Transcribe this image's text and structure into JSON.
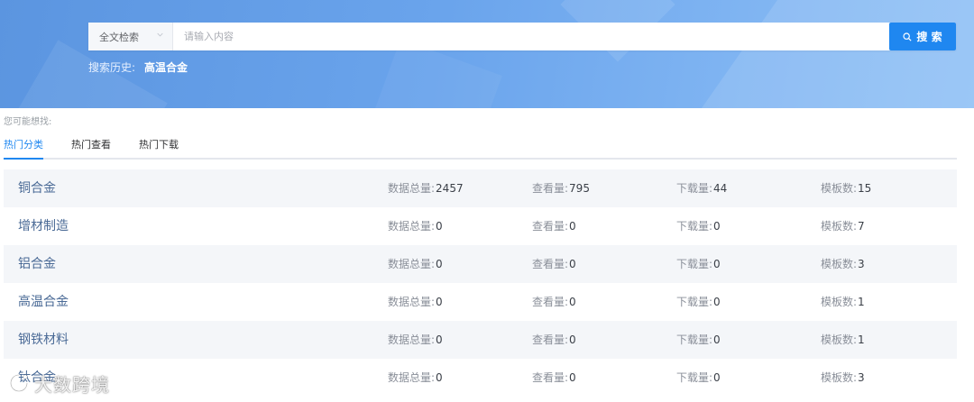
{
  "search": {
    "scope": "全文检索",
    "placeholder": "请输入内容",
    "button_label": "搜 索"
  },
  "history": {
    "label": "搜索历史:",
    "items": [
      "高温合金"
    ]
  },
  "suggest_label": "您可能想找:",
  "tabs": [
    {
      "label": "热门分类",
      "active": true
    },
    {
      "label": "热门查看",
      "active": false
    },
    {
      "label": "热门下载",
      "active": false
    }
  ],
  "stat_labels": {
    "total": "数据总量:",
    "views": "查看量:",
    "downloads": "下载量:",
    "templates": "模板数:"
  },
  "rows": [
    {
      "name": "铜合金",
      "total": "2457",
      "views": "795",
      "downloads": "44",
      "templates": "15"
    },
    {
      "name": "增材制造",
      "total": "0",
      "views": "0",
      "downloads": "0",
      "templates": "7"
    },
    {
      "name": "铝合金",
      "total": "0",
      "views": "0",
      "downloads": "0",
      "templates": "3"
    },
    {
      "name": "高温合金",
      "total": "0",
      "views": "0",
      "downloads": "0",
      "templates": "1"
    },
    {
      "name": "钢铁材料",
      "total": "0",
      "views": "0",
      "downloads": "0",
      "templates": "1"
    },
    {
      "name": "钛合金",
      "total": "0",
      "views": "0",
      "downloads": "0",
      "templates": "3"
    }
  ],
  "watermark": "大数跨境",
  "colors": {
    "accent": "#1f87f0",
    "banner": "#6aa4ec",
    "row_alt": "#f4f6f9"
  }
}
